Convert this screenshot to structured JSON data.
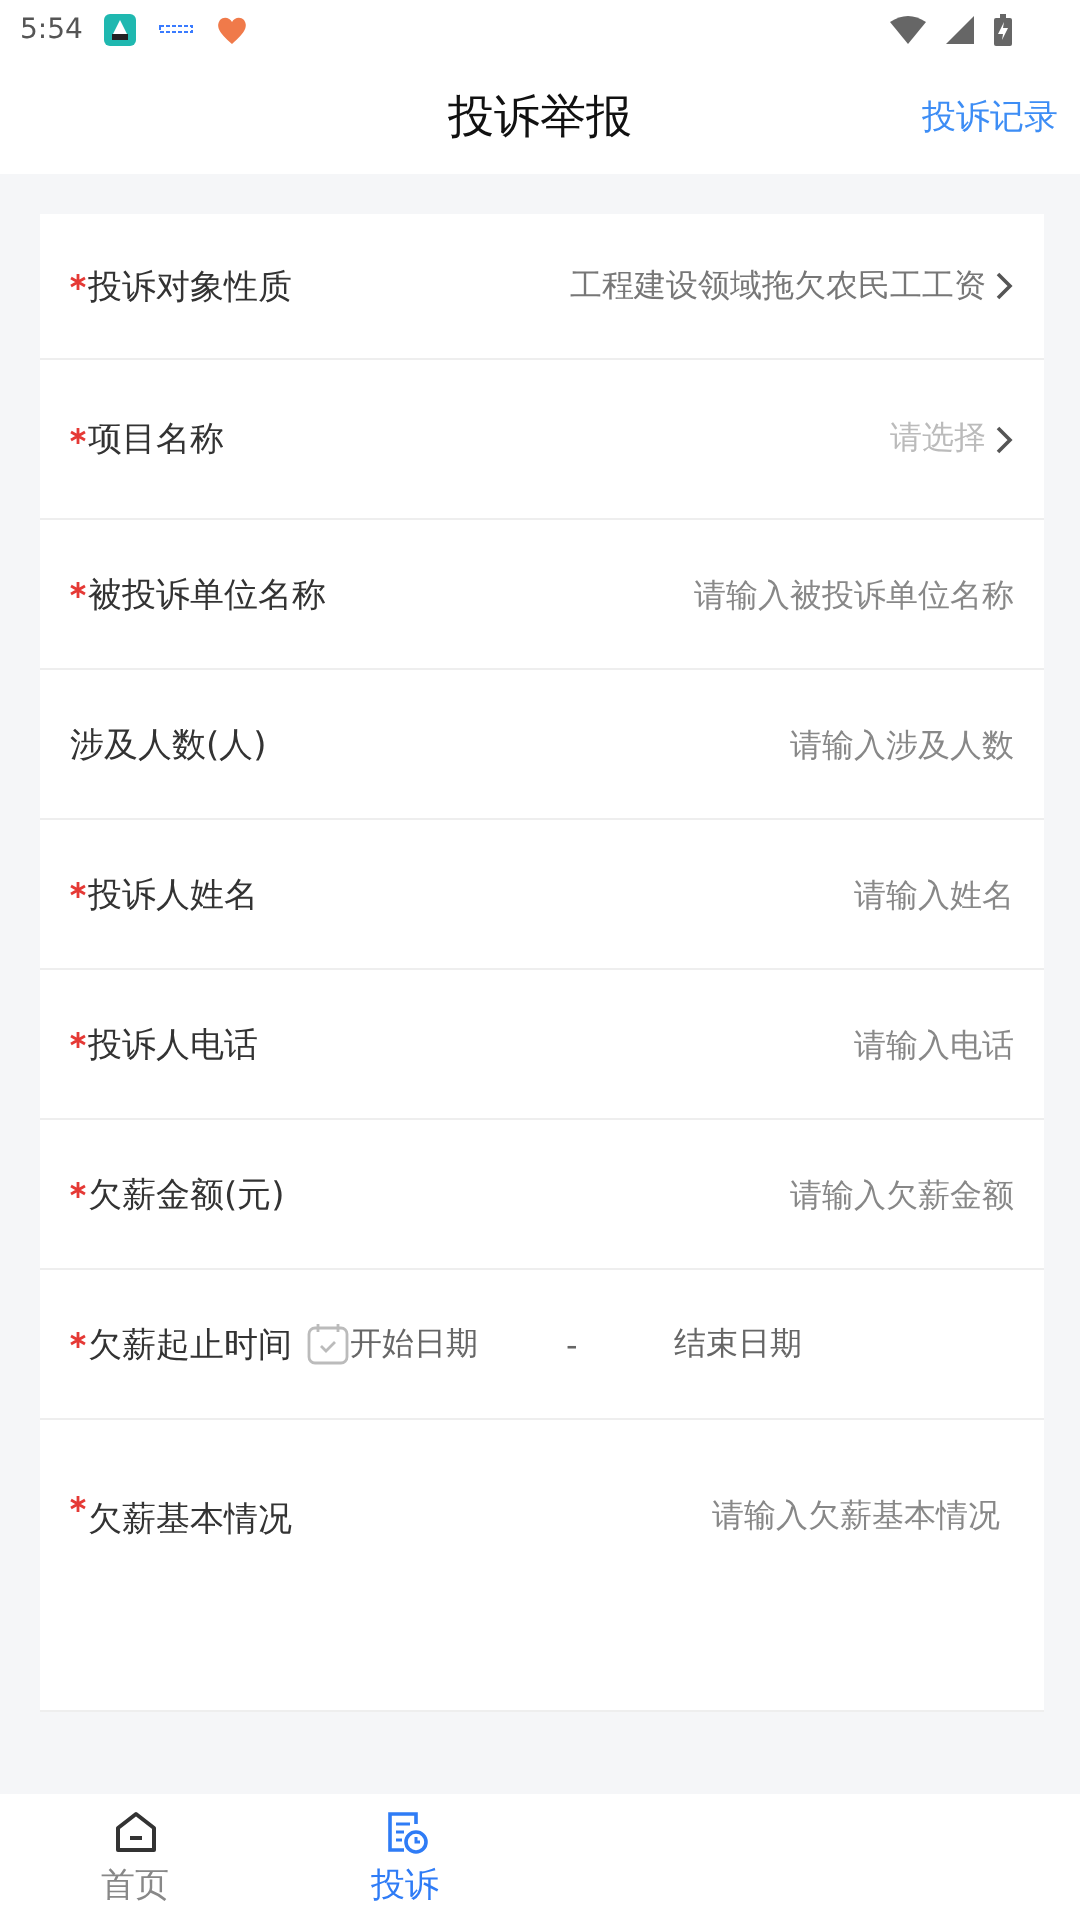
{
  "status_bar": {
    "time": "5:54"
  },
  "header": {
    "title": "投诉举报",
    "action": "投诉记录"
  },
  "form": [
    {
      "kind": "select",
      "label": "投诉对象性质",
      "required": true,
      "value": "工程建设领域拖欠农民工工资"
    },
    {
      "kind": "select",
      "label": "项目名称",
      "required": true,
      "placeholder": "请选择"
    },
    {
      "kind": "input",
      "label": "被投诉单位名称",
      "required": true,
      "placeholder": "请输入被投诉单位名称"
    },
    {
      "kind": "input",
      "label": "涉及人数(人)",
      "required": false,
      "placeholder": "请输入涉及人数"
    },
    {
      "kind": "input",
      "label": "投诉人姓名",
      "required": true,
      "placeholder": "请输入姓名"
    },
    {
      "kind": "input",
      "label": "投诉人电话",
      "required": true,
      "placeholder": "请输入电话"
    },
    {
      "kind": "input",
      "label": "欠薪金额(元)",
      "required": true,
      "placeholder": "请输入欠薪金额"
    },
    {
      "kind": "daterange",
      "label": "欠薪起止时间",
      "required": true,
      "start": "开始日期",
      "separator": "-",
      "end": "结束日期"
    },
    {
      "kind": "textarea",
      "label": "欠薪基本情况",
      "required": true,
      "placeholder": "请输入欠薪基本情况"
    }
  ],
  "tabs": [
    {
      "label": "首页",
      "selected": false
    },
    {
      "label": "投诉",
      "selected": true
    }
  ]
}
